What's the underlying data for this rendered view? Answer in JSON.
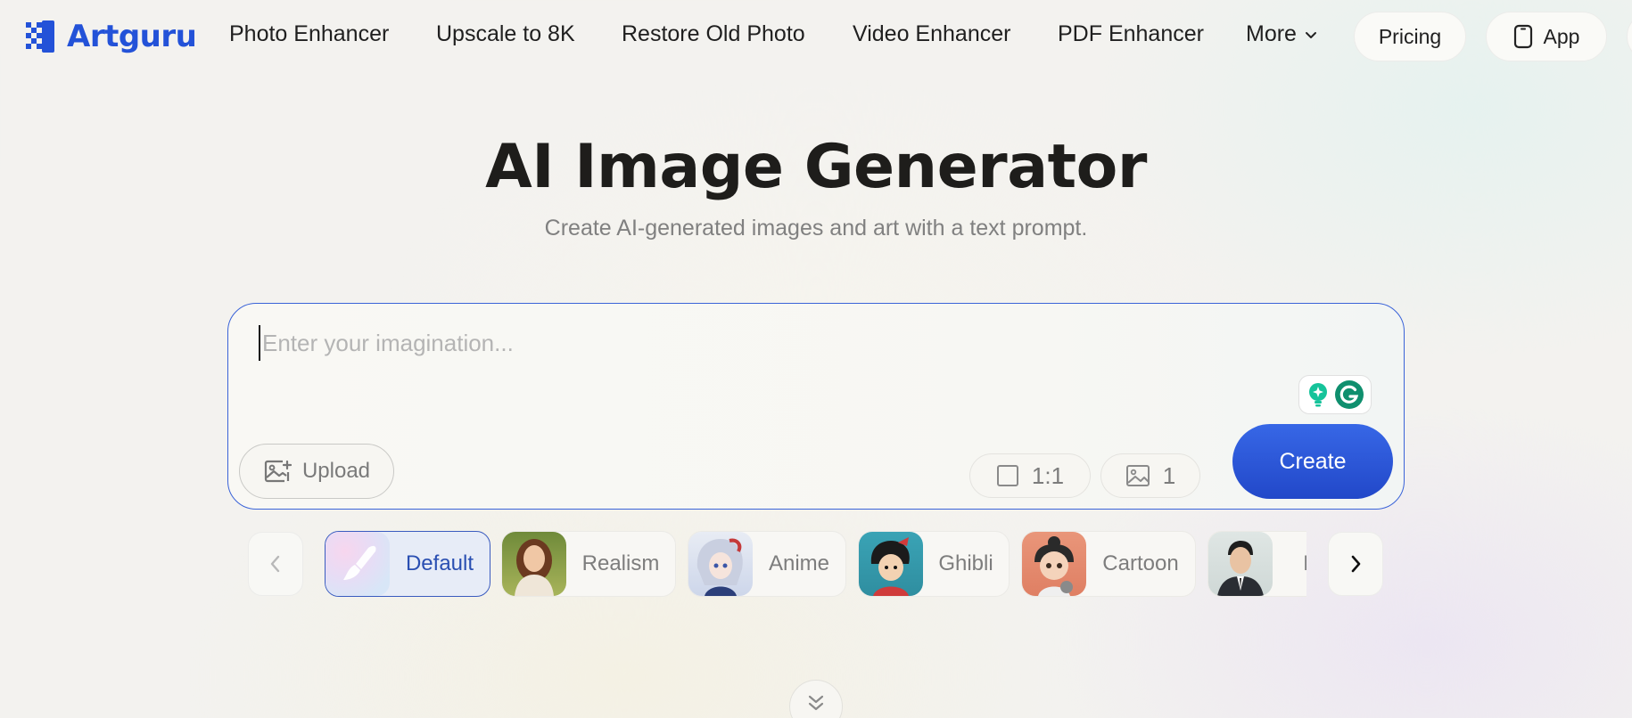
{
  "brand": {
    "name": "Artguru",
    "color": "#2352d8"
  },
  "nav": {
    "links": [
      "Photo Enhancer",
      "Upscale to 8K",
      "Restore Old Photo",
      "Video Enhancer",
      "PDF Enhancer"
    ],
    "more_label": "More",
    "pricing_label": "Pricing",
    "app_label": "App"
  },
  "hero": {
    "title": "AI Image Generator",
    "subtitle": "Create AI-generated images and art with a text prompt."
  },
  "prompt": {
    "placeholder": "Enter your imagination...",
    "value": "",
    "upload_label": "Upload",
    "aspect_ratio": "1:1",
    "image_count": "1",
    "create_label": "Create",
    "accent_color": "#2a55d6"
  },
  "styles": {
    "items": [
      {
        "label": "Default",
        "active": true
      },
      {
        "label": "Realism",
        "active": false
      },
      {
        "label": "Anime",
        "active": false
      },
      {
        "label": "Ghibli",
        "active": false
      },
      {
        "label": "Cartoon",
        "active": false
      },
      {
        "label": "ID",
        "active": false
      }
    ]
  },
  "icons": {
    "logo": "artguru-logo-icon",
    "more": "chevron-down-icon",
    "app": "phone-icon",
    "upload": "image-upload-icon",
    "aspect": "square-icon",
    "count": "image-icon",
    "prev": "chevron-left-icon",
    "next": "chevron-right-icon",
    "scroll": "double-chevron-down-icon",
    "grammarly": "grammarly-icon"
  }
}
